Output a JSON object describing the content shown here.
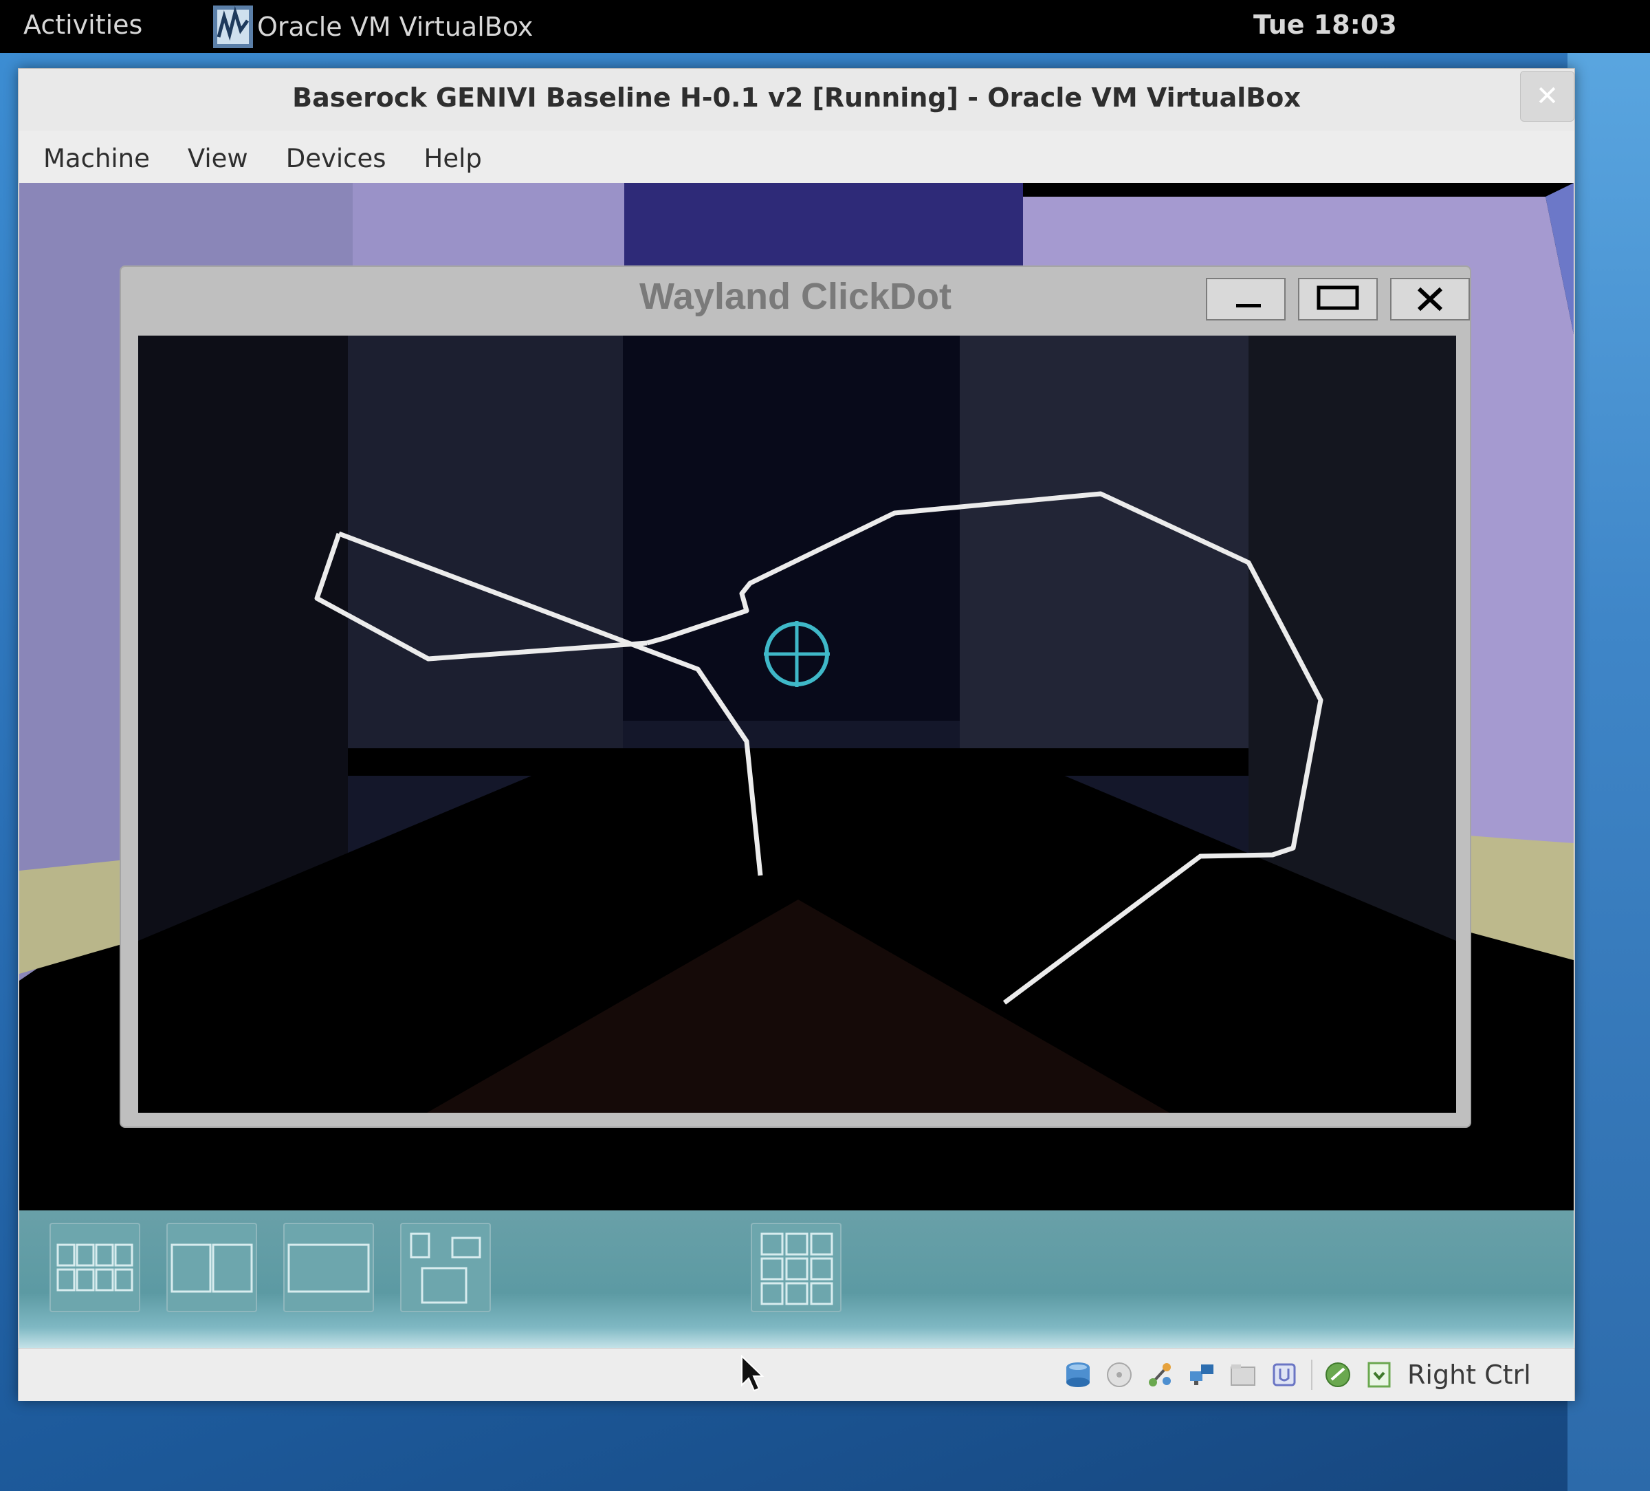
{
  "topbar": {
    "activities": "Activities",
    "app_name": "Oracle VM VirtualBox",
    "clock": "Tue 18:03"
  },
  "vbox": {
    "title": "Baserock GENIVI Baseline H-0.1 v2 [Running] - Oracle VM VirtualBox",
    "close_icon": "close-icon",
    "menus": [
      "Machine",
      "View",
      "Devices",
      "Help"
    ]
  },
  "wayland": {
    "title": "Wayland ClickDot"
  },
  "guest_panel": {
    "buttons": [
      "grid-3x2-icon",
      "split-two-icon",
      "single-window-icon",
      "mixed-layout-icon",
      "app-grid-icon"
    ]
  },
  "statusbar": {
    "icons": [
      "hard-disk-icon",
      "optical-drive-icon",
      "usb-icon",
      "network-icon",
      "shared-folders-icon",
      "video-capture-icon",
      "mouse-integration-icon",
      "keyboard-capture-icon"
    ],
    "host_key": "Right Ctrl"
  },
  "colors": {
    "desktop": "#2a6fb5",
    "topbar": "#000000",
    "crosshair": "#3fb8c8",
    "stroke": "#ededed"
  }
}
